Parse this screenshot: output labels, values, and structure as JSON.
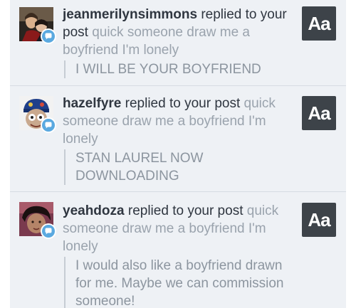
{
  "colors": {
    "background": "#eef1f5",
    "divider": "#d6dbe2",
    "reply_badge": "#5aa9e0",
    "text_post_thumb": "#3d4349"
  },
  "notifications": [
    {
      "username": "jeanmerilynsimmons",
      "verb": "replied to your post",
      "post_title": "quick someone draw me a boyfriend I'm lonely",
      "reply": "I WILL BE YOUR BOYFRIEND",
      "badge_icon": "speech-bubble-icon",
      "thumb_label": "Aa"
    },
    {
      "username": "hazelfyre",
      "verb": "replied to your post",
      "post_title": "quick someone draw me a boyfriend I'm lonely",
      "reply": "STAN LAUREL NOW DOWNLOADING",
      "badge_icon": "speech-bubble-icon",
      "thumb_label": "Aa"
    },
    {
      "username": "yeahdoza",
      "verb": "replied to your post",
      "post_title": "quick someone draw me a boyfriend I'm lonely",
      "reply": "I would also like a boyfriend drawn for me. Maybe we can commission someone!",
      "badge_icon": "speech-bubble-icon",
      "thumb_label": "Aa"
    }
  ]
}
